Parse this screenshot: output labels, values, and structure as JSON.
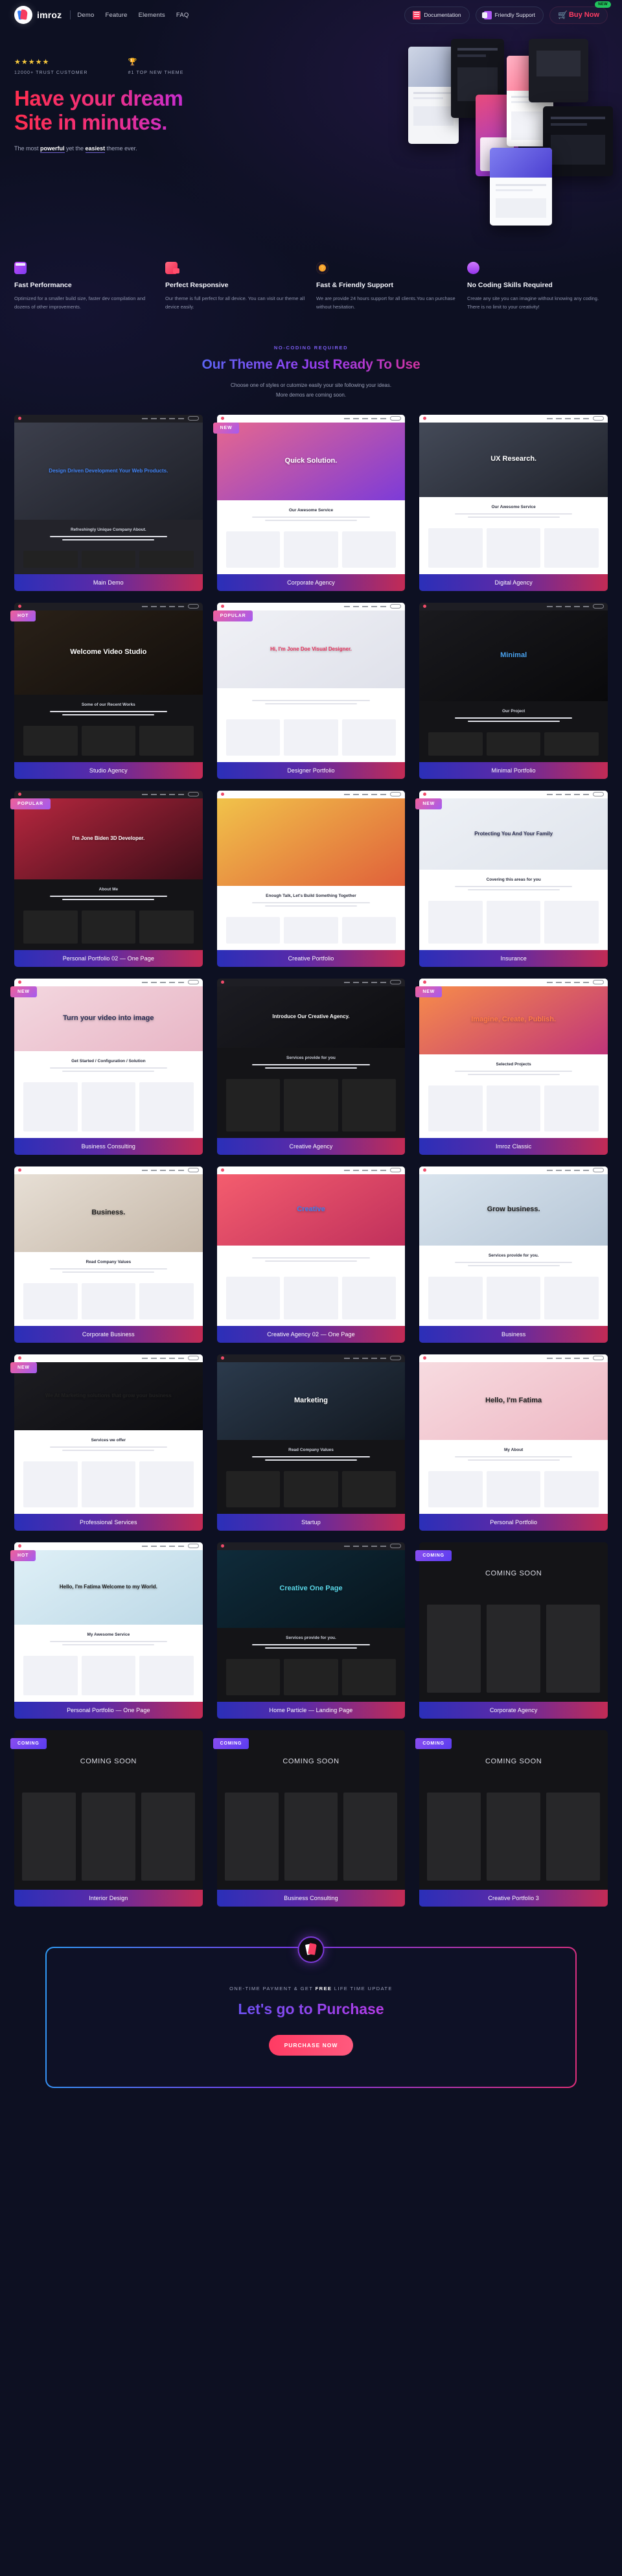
{
  "nav": {
    "brand": "imroz",
    "links": [
      "Demo",
      "Feature",
      "Elements",
      "FAQ"
    ],
    "documentation": "Documentation",
    "support": "Friendly Support",
    "buy": "Buy Now",
    "new_badge": "NEW"
  },
  "hero": {
    "stars": "★★★★★",
    "trust_label": "12000+ TRUST CUSTOMER",
    "trophy": "🏆",
    "theme_label": "#1 TOP NEW THEME",
    "title_line1": "Have your dream",
    "title_line2": "Site in minutes.",
    "sub_pre": "The most ",
    "sub_b1": "powerful",
    "sub_mid": " yet the ",
    "sub_b2": "easiest",
    "sub_post": " theme ever."
  },
  "features": [
    {
      "icon": "speed-icon",
      "title": "Fast Performance",
      "desc": "Optimized for a smaller build size, faster dev compilation and dozens of other improvements."
    },
    {
      "icon": "responsive-icon",
      "title": "Perfect Responsive",
      "desc": "Our theme is full perfect for all device. You can visit our theme all device easily."
    },
    {
      "icon": "support-icon",
      "title": "Fast & Friendly Support",
      "desc": "We are provide 24 hours support for all clients.You can purchase without hesitation."
    },
    {
      "icon": "nocode-icon",
      "title": "No Coding Skills Required",
      "desc": "Create any site you can imagine without knowing any coding. There is no limit to your creativity!"
    }
  ],
  "section": {
    "eyebrow": "NO-CODING REQUIRED",
    "title": "Our Theme Are Just Ready To Use",
    "sub_line1": "Choose one of styles or cutomize easily your site following your ideas.",
    "sub_line2": "More demos are coming soon."
  },
  "demos": [
    {
      "label": "Main Demo",
      "ribbon": "",
      "headline": "Design Driven Development Your Web Products.",
      "sub": "Refreshingly Unique Company About."
    },
    {
      "label": "Corporate Agency",
      "ribbon": "NEW",
      "headline": "Quick Solution.",
      "sub": "Our Awesome Service"
    },
    {
      "label": "Digital Agency",
      "ribbon": "",
      "headline": "UX Research.",
      "sub": "Our Awesome Service"
    },
    {
      "label": "Studio Agency",
      "ribbon": "HOT",
      "headline": "Welcome Video Studio",
      "sub": "Some of our Recent Works"
    },
    {
      "label": "Designer Portfolio",
      "ribbon": "POPULAR",
      "headline": "Hi, I'm Jone Doe Visual Designer.",
      "sub": ""
    },
    {
      "label": "Minimal Portfolio",
      "ribbon": "",
      "headline": "Minimal",
      "sub": "Our Project"
    },
    {
      "label": "Personal Portfolio 02 — One Page",
      "ribbon": "POPULAR",
      "headline": "I'm Jone Biden 3D Developer.",
      "sub": "About Me"
    },
    {
      "label": "Creative Portfolio",
      "ribbon": "",
      "headline": "",
      "sub": "Enough Talk, Let's Build Something Together"
    },
    {
      "label": "Insurance",
      "ribbon": "NEW",
      "headline": "Protecting You And Your Family",
      "sub": "Covering this areas for you"
    },
    {
      "label": "Business Consulting",
      "ribbon": "NEW",
      "headline": "Turn your video into image",
      "sub": "Get Started / Configuration / Solution"
    },
    {
      "label": "Creative Agency",
      "ribbon": "",
      "headline": "Introduce Our Creative Agency.",
      "sub": "Services provide for you"
    },
    {
      "label": "Imroz Classic",
      "ribbon": "NEW",
      "headline": "Imagine, Create, Publish.",
      "sub": "Selected Projects"
    },
    {
      "label": "Corporate Business",
      "ribbon": "",
      "headline": "Business.",
      "sub": "Read Company Values"
    },
    {
      "label": "Creative Agency 02 — One Page",
      "ribbon": "",
      "headline": "Creative",
      "sub": ""
    },
    {
      "label": "Business",
      "ribbon": "",
      "headline": "Grow business.",
      "sub": "Services provide for you."
    },
    {
      "label": "Professional Services",
      "ribbon": "NEW",
      "headline": "We At Marketing solutions that grow your business",
      "sub": "Services we offer"
    },
    {
      "label": "Startup",
      "ribbon": "",
      "headline": "Marketing",
      "sub": "Read Company Values"
    },
    {
      "label": "Personal Portfolio",
      "ribbon": "",
      "headline": "Hello, I'm Fatima",
      "sub": "My About"
    },
    {
      "label": "Personal Portfolio — One Page",
      "ribbon": "HOT",
      "headline": "Hello, I'm Fatima Welcome to my World.",
      "sub": "My Awesome Service"
    },
    {
      "label": "Home Particle — Landing Page",
      "ribbon": "",
      "headline": "Creative One Page",
      "sub": "Services provide for you."
    },
    {
      "label": "Corporate Agency",
      "ribbon": "COMING",
      "headline": "COMING SOON",
      "sub": ""
    },
    {
      "label": "Interior Design",
      "ribbon": "COMING",
      "headline": "COMING SOON",
      "sub": ""
    },
    {
      "label": "Business Consulting",
      "ribbon": "COMING",
      "headline": "COMING SOON",
      "sub": ""
    },
    {
      "label": "Creative Portfolio 3",
      "ribbon": "COMING",
      "headline": "COMING SOON",
      "sub": ""
    }
  ],
  "ribbon_labels": {
    "NEW": "NEW",
    "HOT": "HOT",
    "POPULAR": "POPULAR",
    "COMING": "COMING"
  },
  "cta": {
    "eyebrow_pre": "ONE-TIME PAYMENT & GET ",
    "eyebrow_b": "FREE",
    "eyebrow_post": " LIFE TIME UPDATE",
    "title": "Let's go to Purchase",
    "button": "PURCHASE NOW"
  },
  "colors": {
    "bg": "#0d1022",
    "accent_pink": "#ff3b63",
    "accent_purple": "#7b3bf0",
    "accent_blue": "#2f9cf7",
    "label_gradient_from": "#2b2fb8",
    "label_gradient_to": "#c22b55"
  }
}
